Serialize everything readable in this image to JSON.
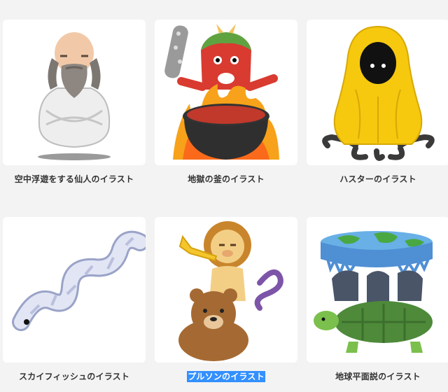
{
  "items": [
    {
      "caption": "空中浮遊をする仙人のイラスト",
      "selected": false,
      "icon": "floating-hermit"
    },
    {
      "caption": "地獄の釜のイラスト",
      "selected": false,
      "icon": "hell-cauldron-oni"
    },
    {
      "caption": "ハスターのイラスト",
      "selected": false,
      "icon": "hastur"
    },
    {
      "caption": "スカイフィッシュのイラスト",
      "selected": false,
      "icon": "skyfish"
    },
    {
      "caption": "プルソンのイラスト",
      "selected": true,
      "icon": "purson"
    },
    {
      "caption": "地球平面説のイラスト",
      "selected": false,
      "icon": "flat-earth"
    }
  ],
  "colors": {
    "selection": "#3390ff",
    "background": "#f3f3f3",
    "card": "#ffffff"
  }
}
